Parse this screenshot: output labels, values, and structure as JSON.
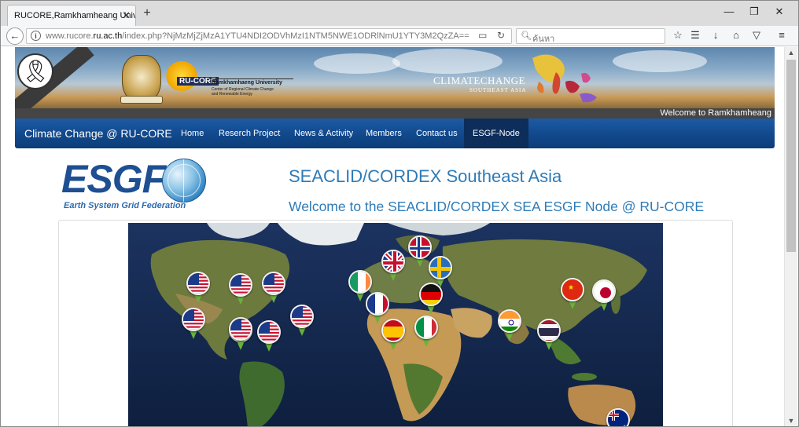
{
  "browser": {
    "tab_title": "RUCORE,Ramkhamheang Univer",
    "tab_close": "✕",
    "new_tab": "+",
    "window_min": "—",
    "window_restore": "❐",
    "window_close": "✕",
    "url_prefix": "www.rucore.",
    "url_domain": "ru.ac.th",
    "url_path": "/index.php?NjMzMjZjMzA1YTU4NDI2ODVhMzI1NTM5NWE1ODRlNmU1YTY3M2QzZA==",
    "search_placeholder": "ค้นหา"
  },
  "banner": {
    "rucore_label": "RU-CORE",
    "university_name": "Ramkhamhaeng University",
    "university_sub1": "Center of Regional Climate Change",
    "university_sub2": "and Renewable Energy",
    "climate_title": "CLIMATECHANGE",
    "climate_sub": "SOUTHEAST ASIA",
    "marquee": "Welcome to Ramkhamheang"
  },
  "menu": {
    "brand": "Climate Change @ RU-CORE",
    "items": [
      {
        "label": "Home",
        "active": false
      },
      {
        "label": "Reserch Project",
        "active": false
      },
      {
        "label": "News & Activity",
        "active": false
      },
      {
        "label": "Members",
        "active": false
      },
      {
        "label": "Contact us",
        "active": false
      },
      {
        "label": "ESGF-Node",
        "active": true
      }
    ]
  },
  "esgf": {
    "logo_letters": "ESGF",
    "tagline": "Earth System Grid Federation"
  },
  "main": {
    "title": "SEACLID/CORDEX Southeast Asia",
    "subtitle": "Welcome to the SEACLID/CORDEX SEA ESGF Node @ RU-CORE"
  },
  "map": {
    "pins": [
      {
        "country": "usa"
      },
      {
        "country": "usa"
      },
      {
        "country": "usa"
      },
      {
        "country": "usa"
      },
      {
        "country": "usa"
      },
      {
        "country": "usa"
      },
      {
        "country": "usa"
      },
      {
        "country": "usa"
      },
      {
        "country": "norway"
      },
      {
        "country": "uk"
      },
      {
        "country": "sweden"
      },
      {
        "country": "ireland"
      },
      {
        "country": "france"
      },
      {
        "country": "germany"
      },
      {
        "country": "spain"
      },
      {
        "country": "italy"
      },
      {
        "country": "india"
      },
      {
        "country": "thailand"
      },
      {
        "country": "china"
      },
      {
        "country": "japan"
      },
      {
        "country": "australia"
      }
    ]
  },
  "colors": {
    "menu_bar": "#124a8e",
    "menu_active": "#0d2d5a",
    "title_blue": "#2e7bb7",
    "esgf_blue": "#1d4f92",
    "pin_green": "#6bb23c"
  }
}
